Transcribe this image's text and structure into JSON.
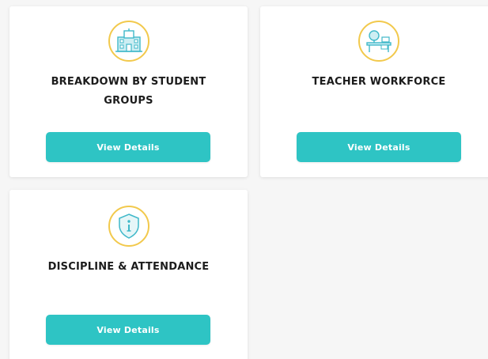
{
  "cards": [
    {
      "title": "BREAKDOWN BY STUDENT GROUPS",
      "icon": "school-building-icon",
      "button_label": "View Details"
    },
    {
      "title": "TEACHER WORKFORCE",
      "icon": "teacher-desk-icon",
      "button_label": "View Details"
    },
    {
      "title": "DISCIPLINE & ATTENDANCE",
      "icon": "info-shield-icon",
      "button_label": "View Details"
    }
  ],
  "colors": {
    "accent": "#2ec4c4",
    "icon_ring": "#f2c94c",
    "icon_stroke": "#3fb8c9"
  }
}
